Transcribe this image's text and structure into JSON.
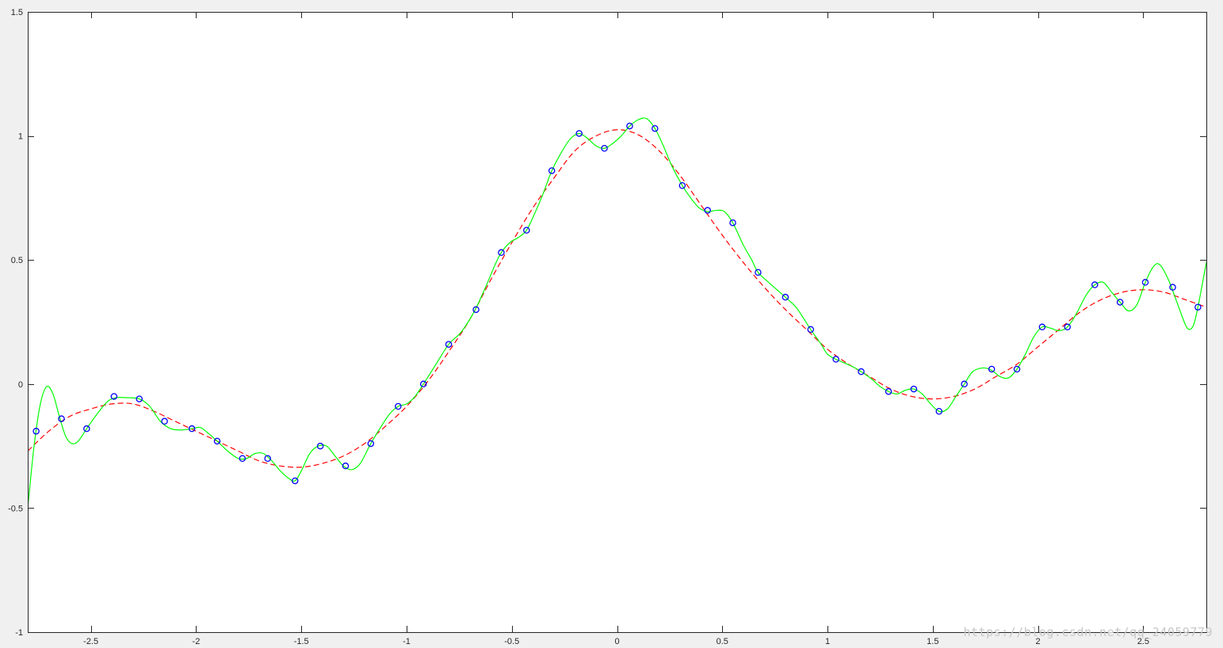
{
  "chart_data": {
    "type": "line",
    "title": "",
    "xlabel": "",
    "ylabel": "",
    "xlim": [
      -2.8,
      2.8
    ],
    "ylim": [
      -1,
      1.5
    ],
    "x_ticks": [
      -2.5,
      -2,
      -1.5,
      -1,
      -0.5,
      0,
      0.5,
      1,
      1.5,
      2,
      2.5
    ],
    "x_tick_labels": [
      "-2.5",
      "-2",
      "-1.5",
      "-1",
      "-0.5",
      "0",
      "0.5",
      "1",
      "1.5",
      "2",
      "2.5"
    ],
    "y_ticks": [
      -1,
      -0.5,
      0,
      0.5,
      1,
      1.5
    ],
    "y_tick_labels": [
      "-1",
      "-0.5",
      "0",
      "0.5",
      "1",
      "1.5"
    ],
    "grid": false,
    "legend": "none",
    "series": [
      {
        "style": "markers",
        "marker": "circle",
        "color": "#0000ff",
        "points": [
          [
            -2.76,
            -0.19
          ],
          [
            -2.64,
            -0.14
          ],
          [
            -2.52,
            -0.18
          ],
          [
            -2.39,
            -0.05
          ],
          [
            -2.27,
            -0.06
          ],
          [
            -2.15,
            -0.15
          ],
          [
            -2.02,
            -0.18
          ],
          [
            -1.9,
            -0.23
          ],
          [
            -1.78,
            -0.3
          ],
          [
            -1.66,
            -0.3
          ],
          [
            -1.53,
            -0.39
          ],
          [
            -1.41,
            -0.25
          ],
          [
            -1.29,
            -0.33
          ],
          [
            -1.17,
            -0.24
          ],
          [
            -1.04,
            -0.09
          ],
          [
            -0.92,
            0.0
          ],
          [
            -0.8,
            0.16
          ],
          [
            -0.67,
            0.3
          ],
          [
            -0.55,
            0.53
          ],
          [
            -0.43,
            0.62
          ],
          [
            -0.31,
            0.86
          ],
          [
            -0.18,
            1.01
          ],
          [
            -0.06,
            0.95
          ],
          [
            0.06,
            1.04
          ],
          [
            0.18,
            1.03
          ],
          [
            0.31,
            0.8
          ],
          [
            0.43,
            0.7
          ],
          [
            0.55,
            0.65
          ],
          [
            0.67,
            0.45
          ],
          [
            0.8,
            0.35
          ],
          [
            0.92,
            0.22
          ],
          [
            1.04,
            0.1
          ],
          [
            1.16,
            0.05
          ],
          [
            1.29,
            -0.03
          ],
          [
            1.41,
            -0.02
          ],
          [
            1.53,
            -0.11
          ],
          [
            1.65,
            0.0
          ],
          [
            1.78,
            0.06
          ],
          [
            1.9,
            0.06
          ],
          [
            2.02,
            0.23
          ],
          [
            2.14,
            0.23
          ],
          [
            2.27,
            0.4
          ],
          [
            2.39,
            0.33
          ],
          [
            2.51,
            0.41
          ],
          [
            2.64,
            0.39
          ],
          [
            2.76,
            0.31
          ]
        ]
      },
      {
        "style": "dashed",
        "color": "#ff0000",
        "points": [
          [
            -2.8,
            -0.27
          ],
          [
            -2.7,
            -0.19
          ],
          [
            -2.6,
            -0.13
          ],
          [
            -2.5,
            -0.1
          ],
          [
            -2.4,
            -0.08
          ],
          [
            -2.3,
            -0.08
          ],
          [
            -2.2,
            -0.11
          ],
          [
            -2.1,
            -0.15
          ],
          [
            -2.0,
            -0.19
          ],
          [
            -1.9,
            -0.23
          ],
          [
            -1.8,
            -0.27
          ],
          [
            -1.7,
            -0.31
          ],
          [
            -1.6,
            -0.33
          ],
          [
            -1.5,
            -0.335
          ],
          [
            -1.4,
            -0.32
          ],
          [
            -1.3,
            -0.29
          ],
          [
            -1.2,
            -0.24
          ],
          [
            -1.1,
            -0.17
          ],
          [
            -1.0,
            -0.09
          ],
          [
            -0.9,
            0.01
          ],
          [
            -0.8,
            0.13
          ],
          [
            -0.7,
            0.26
          ],
          [
            -0.6,
            0.42
          ],
          [
            -0.5,
            0.57
          ],
          [
            -0.4,
            0.71
          ],
          [
            -0.3,
            0.83
          ],
          [
            -0.2,
            0.94
          ],
          [
            -0.1,
            1.0
          ],
          [
            0.0,
            1.025
          ],
          [
            0.1,
            1.005
          ],
          [
            0.2,
            0.94
          ],
          [
            0.3,
            0.84
          ],
          [
            0.4,
            0.72
          ],
          [
            0.5,
            0.6
          ],
          [
            0.6,
            0.49
          ],
          [
            0.7,
            0.39
          ],
          [
            0.8,
            0.3
          ],
          [
            0.9,
            0.22
          ],
          [
            1.0,
            0.14
          ],
          [
            1.1,
            0.08
          ],
          [
            1.2,
            0.03
          ],
          [
            1.3,
            -0.02
          ],
          [
            1.4,
            -0.05
          ],
          [
            1.5,
            -0.06
          ],
          [
            1.6,
            -0.05
          ],
          [
            1.7,
            -0.02
          ],
          [
            1.8,
            0.03
          ],
          [
            1.9,
            0.08
          ],
          [
            2.0,
            0.15
          ],
          [
            2.1,
            0.22
          ],
          [
            2.2,
            0.29
          ],
          [
            2.3,
            0.34
          ],
          [
            2.4,
            0.37
          ],
          [
            2.5,
            0.38
          ],
          [
            2.6,
            0.37
          ],
          [
            2.7,
            0.34
          ],
          [
            2.8,
            0.31
          ]
        ]
      },
      {
        "style": "solid",
        "color": "#00ff00",
        "points": [
          [
            -2.8,
            -0.5
          ],
          [
            -2.77,
            -0.25
          ],
          [
            -2.74,
            -0.08
          ],
          [
            -2.71,
            -0.01
          ],
          [
            -2.68,
            -0.04
          ],
          [
            -2.65,
            -0.13
          ],
          [
            -2.62,
            -0.21
          ],
          [
            -2.59,
            -0.24
          ],
          [
            -2.56,
            -0.23
          ],
          [
            -2.52,
            -0.18
          ],
          [
            -2.47,
            -0.12
          ],
          [
            -2.42,
            -0.07
          ],
          [
            -2.38,
            -0.055
          ],
          [
            -2.33,
            -0.055
          ],
          [
            -2.27,
            -0.06
          ],
          [
            -2.22,
            -0.09
          ],
          [
            -2.17,
            -0.15
          ],
          [
            -2.12,
            -0.18
          ],
          [
            -2.07,
            -0.185
          ],
          [
            -2.02,
            -0.18
          ],
          [
            -1.98,
            -0.175
          ],
          [
            -1.94,
            -0.2
          ],
          [
            -1.9,
            -0.23
          ],
          [
            -1.85,
            -0.27
          ],
          [
            -1.8,
            -0.3
          ],
          [
            -1.76,
            -0.3
          ],
          [
            -1.72,
            -0.28
          ],
          [
            -1.68,
            -0.28
          ],
          [
            -1.64,
            -0.31
          ],
          [
            -1.6,
            -0.35
          ],
          [
            -1.56,
            -0.38
          ],
          [
            -1.53,
            -0.39
          ],
          [
            -1.5,
            -0.35
          ],
          [
            -1.46,
            -0.28
          ],
          [
            -1.42,
            -0.25
          ],
          [
            -1.38,
            -0.25
          ],
          [
            -1.34,
            -0.29
          ],
          [
            -1.3,
            -0.33
          ],
          [
            -1.26,
            -0.345
          ],
          [
            -1.22,
            -0.32
          ],
          [
            -1.17,
            -0.24
          ],
          [
            -1.12,
            -0.17
          ],
          [
            -1.08,
            -0.12
          ],
          [
            -1.04,
            -0.09
          ],
          [
            -1.0,
            -0.08
          ],
          [
            -0.96,
            -0.05
          ],
          [
            -0.92,
            0.0
          ],
          [
            -0.86,
            0.08
          ],
          [
            -0.8,
            0.16
          ],
          [
            -0.74,
            0.21
          ],
          [
            -0.68,
            0.29
          ],
          [
            -0.63,
            0.38
          ],
          [
            -0.58,
            0.48
          ],
          [
            -0.55,
            0.53
          ],
          [
            -0.51,
            0.57
          ],
          [
            -0.47,
            0.59
          ],
          [
            -0.43,
            0.62
          ],
          [
            -0.39,
            0.69
          ],
          [
            -0.35,
            0.77
          ],
          [
            -0.31,
            0.86
          ],
          [
            -0.26,
            0.94
          ],
          [
            -0.22,
            0.99
          ],
          [
            -0.18,
            1.01
          ],
          [
            -0.14,
            0.99
          ],
          [
            -0.1,
            0.96
          ],
          [
            -0.06,
            0.95
          ],
          [
            -0.02,
            0.97
          ],
          [
            0.02,
            1.0
          ],
          [
            0.06,
            1.04
          ],
          [
            0.1,
            1.065
          ],
          [
            0.14,
            1.07
          ],
          [
            0.18,
            1.03
          ],
          [
            0.22,
            0.96
          ],
          [
            0.26,
            0.88
          ],
          [
            0.31,
            0.8
          ],
          [
            0.35,
            0.75
          ],
          [
            0.39,
            0.71
          ],
          [
            0.43,
            0.695
          ],
          [
            0.47,
            0.7
          ],
          [
            0.51,
            0.695
          ],
          [
            0.55,
            0.65
          ],
          [
            0.6,
            0.56
          ],
          [
            0.64,
            0.5
          ],
          [
            0.67,
            0.45
          ],
          [
            0.72,
            0.41
          ],
          [
            0.76,
            0.38
          ],
          [
            0.8,
            0.35
          ],
          [
            0.85,
            0.31
          ],
          [
            0.89,
            0.26
          ],
          [
            0.92,
            0.22
          ],
          [
            0.97,
            0.16
          ],
          [
            1.0,
            0.12
          ],
          [
            1.04,
            0.1
          ],
          [
            1.08,
            0.085
          ],
          [
            1.12,
            0.07
          ],
          [
            1.16,
            0.05
          ],
          [
            1.21,
            0.02
          ],
          [
            1.25,
            -0.01
          ],
          [
            1.29,
            -0.03
          ],
          [
            1.33,
            -0.04
          ],
          [
            1.37,
            -0.025
          ],
          [
            1.41,
            -0.02
          ],
          [
            1.45,
            -0.04
          ],
          [
            1.49,
            -0.08
          ],
          [
            1.53,
            -0.11
          ],
          [
            1.57,
            -0.1
          ],
          [
            1.61,
            -0.05
          ],
          [
            1.65,
            0.0
          ],
          [
            1.69,
            0.05
          ],
          [
            1.74,
            0.065
          ],
          [
            1.78,
            0.055
          ],
          [
            1.82,
            0.03
          ],
          [
            1.86,
            0.025
          ],
          [
            1.9,
            0.06
          ],
          [
            1.94,
            0.12
          ],
          [
            1.98,
            0.19
          ],
          [
            2.02,
            0.23
          ],
          [
            2.06,
            0.225
          ],
          [
            2.1,
            0.215
          ],
          [
            2.14,
            0.23
          ],
          [
            2.18,
            0.28
          ],
          [
            2.23,
            0.36
          ],
          [
            2.27,
            0.4
          ],
          [
            2.31,
            0.41
          ],
          [
            2.35,
            0.37
          ],
          [
            2.39,
            0.33
          ],
          [
            2.43,
            0.295
          ],
          [
            2.47,
            0.32
          ],
          [
            2.51,
            0.41
          ],
          [
            2.55,
            0.475
          ],
          [
            2.58,
            0.48
          ],
          [
            2.62,
            0.42
          ],
          [
            2.66,
            0.33
          ],
          [
            2.7,
            0.24
          ],
          [
            2.72,
            0.22
          ],
          [
            2.74,
            0.24
          ],
          [
            2.76,
            0.31
          ],
          [
            2.78,
            0.4
          ],
          [
            2.8,
            0.49
          ]
        ]
      }
    ]
  },
  "watermark": "https://blog.csdn.net/qq_24059779"
}
